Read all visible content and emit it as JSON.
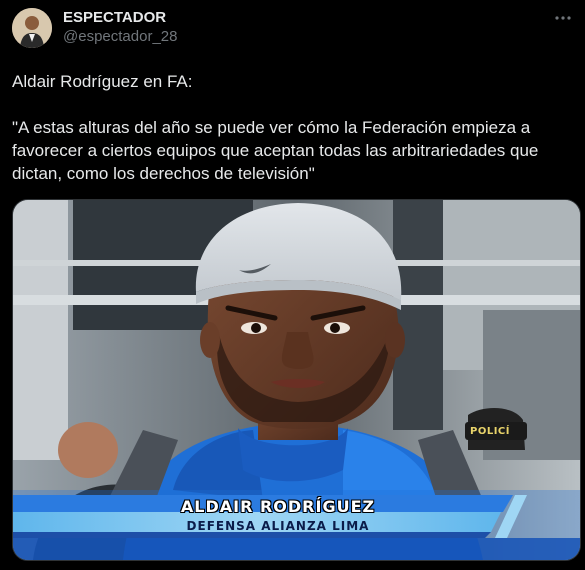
{
  "author": {
    "display_name": "ESPECTADOR",
    "handle": "@espectador_28"
  },
  "more_icon": "more-horizontal-icon",
  "tweet": {
    "line1": "Aldair Rodríguez en FA:",
    "line2": "\"A estas alturas del año se puede ver cómo la Federación empieza a favorecer a ciertos equipos que aceptan todas las arbitrariedades que dictan, como los derechos de televisión\""
  },
  "media": {
    "lower_third_name": "ALDAIR RODRÍGUEZ",
    "lower_third_role": "DEFENSA ALIANZA LIMA",
    "background_patch_text": "POLICÍ"
  },
  "colors": {
    "background": "#000000",
    "text": "#e7e9ea",
    "muted": "#71767b",
    "jacket_blue": "#1f6fd6",
    "banner_blue": "#2b7be0",
    "banner_light": "#a8d8f4"
  }
}
